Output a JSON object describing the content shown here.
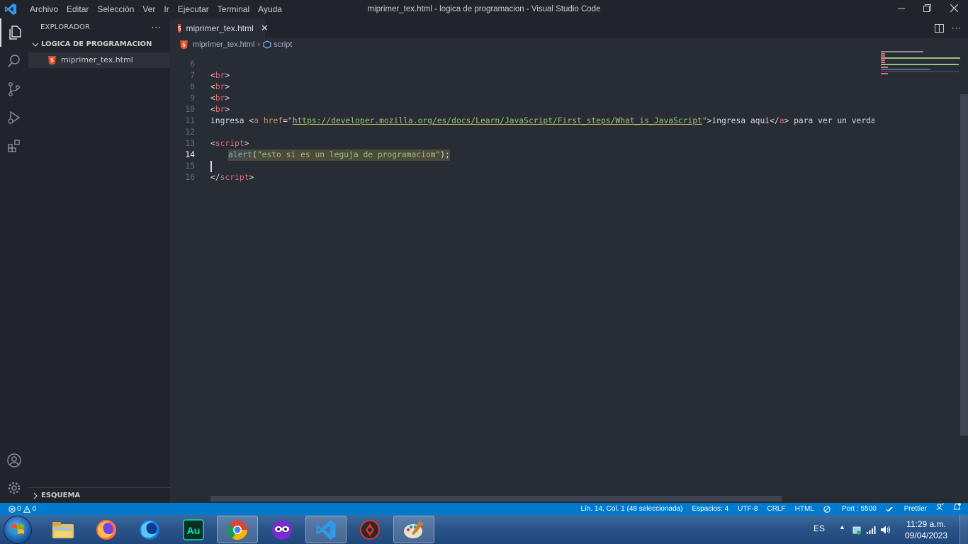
{
  "titlebar": {
    "menu": [
      "Archivo",
      "Editar",
      "Selección",
      "Ver",
      "Ir",
      "Ejecutar",
      "Terminal",
      "Ayuda"
    ],
    "window_title": "miprimer_tex.html - logica de programacion - Visual Studio Code"
  },
  "sidebar": {
    "header": "EXPLORADOR",
    "folder": "LOGICA DE PROGRAMACION",
    "file": "miprimer_tex.html",
    "outline": "ESQUEMA"
  },
  "tabs": [
    {
      "label": "miprimer_tex.html"
    }
  ],
  "breadcrumb": {
    "file": "miprimer_tex.html",
    "symbol": "script"
  },
  "editor": {
    "line_numbers": [
      "6",
      "7",
      "8",
      "9",
      "10",
      "11",
      "12",
      "13",
      "14",
      "15",
      "16"
    ],
    "current_line": 14,
    "lines": {
      "l6": {
        "open": "<",
        "tag": "br",
        "close": ">"
      },
      "l7": {
        "open": "<",
        "tag": "br",
        "close": ">"
      },
      "l8": {
        "open": "<",
        "tag": "br",
        "close": ">"
      },
      "l9": {
        "open": "<",
        "tag": "br",
        "close": ">"
      },
      "l10": {
        "t1": "ingresa ",
        "t2": "<",
        "t3": "a",
        "t4": " ",
        "t5": "href",
        "t6": "=",
        "t7": "\"",
        "t8": "https://developer.mozilla.org/es/docs/Learn/JavaScript/First_steps/What_is_JavaScript",
        "t9": "\"",
        "t10": ">",
        "t11": "ingresa aqui",
        "t12": "</",
        "t13": "a",
        "t14": ">",
        "t15": " para ver un verdaderp len"
      },
      "l12": {
        "open": "<",
        "tag": "script",
        "close": ">"
      },
      "l13": {
        "fn": "alert",
        "open": "(",
        "str": "\"esto si es un leguja de programaciom\"",
        "close": ");"
      },
      "l15": {
        "open": "</",
        "tag": "script",
        "close": ">"
      }
    }
  },
  "statusbar": {
    "errors": "0",
    "warnings": "0",
    "position": "Lín. 14, Col. 1 (48 seleccionada)",
    "spaces": "Espacios: 4",
    "encoding": "UTF-8",
    "eol": "CRLF",
    "language": "HTML",
    "port": "Port : 5500",
    "prettier": "Prettier"
  },
  "taskbar": {
    "apps": [
      "explorer-icon",
      "firefox-icon",
      "firefox-dev-icon",
      "audition-icon",
      "chrome-icon",
      "gmod-icon",
      "vscode-icon",
      "app-icon",
      "paint-icon"
    ],
    "language": "ES",
    "time": "11:29 a.m.",
    "date": "09/04/2023"
  },
  "colors": {
    "accent": "#007acc",
    "editor_bg": "#282c34",
    "sidebar_bg": "#21252b",
    "tag": "#e06c75",
    "attribute": "#d19a66",
    "string": "#98c379",
    "function": "#61afef"
  }
}
